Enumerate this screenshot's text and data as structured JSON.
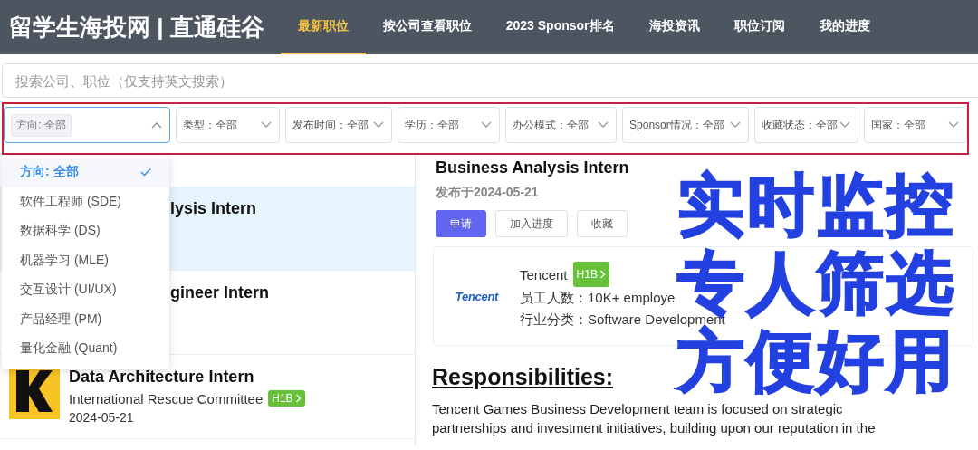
{
  "navbar": {
    "logo": "留学生海投网 | 直通硅谷",
    "items": [
      {
        "label": "最新职位",
        "selected": true
      },
      {
        "label": "按公司查看职位",
        "selected": false
      },
      {
        "label": "2023 Sponsor排名",
        "selected": false
      },
      {
        "label": "海投资讯",
        "selected": false
      },
      {
        "label": "职位订阅",
        "selected": false
      },
      {
        "label": "我的进度",
        "selected": false
      }
    ]
  },
  "search": {
    "placeholder": "搜索公司、职位（仅支持英文搜索）"
  },
  "filters": [
    {
      "label": "方向: 全部",
      "kind": "tag",
      "expanded": true
    },
    {
      "label": "类型：全部",
      "kind": "plain",
      "expanded": false
    },
    {
      "label": "发布时间：全部",
      "kind": "plain",
      "expanded": false
    },
    {
      "label": "学历：全部",
      "kind": "plain",
      "expanded": false
    },
    {
      "label": "办公模式：全部",
      "kind": "plain",
      "expanded": false
    },
    {
      "label": "Sponsor情况：全部",
      "kind": "plain",
      "expanded": false
    },
    {
      "label": "收藏状态：全部",
      "kind": "plain",
      "expanded": false
    },
    {
      "label": "国家：全部",
      "kind": "plain",
      "expanded": false
    }
  ],
  "dropdown": {
    "options": [
      {
        "label": "方向: 全部",
        "selected": true
      },
      {
        "label": "软件工程师 (SDE)",
        "selected": false
      },
      {
        "label": "数据科学 (DS)",
        "selected": false
      },
      {
        "label": "机器学习 (MLE)",
        "selected": false
      },
      {
        "label": "交互设计 (UI/UX)",
        "selected": false
      },
      {
        "label": "产品经理 (PM)",
        "selected": false
      },
      {
        "label": "量化金融 (Quant)",
        "selected": false
      }
    ]
  },
  "job_list": [
    {
      "kind": "covered",
      "title": "lysis Intern",
      "selected": true
    },
    {
      "kind": "covered",
      "title": "gineer Intern",
      "selected": false
    },
    {
      "kind": "full",
      "title": "Data Architecture Intern",
      "company": "International Rescue Committee",
      "badge": "H1B",
      "date": "2024-05-21",
      "selected": false
    }
  ],
  "detail": {
    "title": "Business Analysis Intern",
    "posted": "发布于2024-05-21",
    "buttons": [
      {
        "label": "申请",
        "kind": "primary"
      },
      {
        "label": "加入进度",
        "kind": "default"
      },
      {
        "label": "收藏",
        "kind": "default"
      }
    ],
    "company": {
      "logo_text": "Tencent",
      "name": "Tencent",
      "badge": "H1B",
      "facts": [
        {
          "label": "员工人数：",
          "value": "10K+ employe"
        },
        {
          "label": "行业分类：",
          "value": "Software Development"
        }
      ]
    },
    "section_heading": "Responsibilities:",
    "paragraph_lines": [
      "Tencent Games Business Development team is focused on strategic",
      "partnerships and investment initiatives, building upon our reputation in the"
    ]
  },
  "promo": {
    "lines": [
      "实时监控",
      "专人筛选",
      "方便好用"
    ]
  }
}
